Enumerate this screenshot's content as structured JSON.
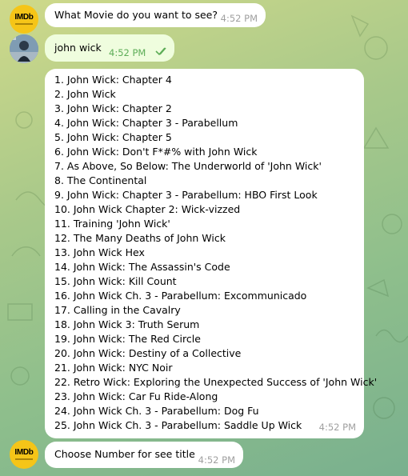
{
  "messages": [
    {
      "sender": "bot",
      "avatar_label": "IMDb",
      "text": "What Movie do you want to see?",
      "time": "4:52 PM"
    },
    {
      "sender": "user",
      "text": "john wick",
      "time": "4:52 PM",
      "status_icon": "double-check-icon"
    },
    {
      "sender": "bot",
      "time": "4:52 PM",
      "list": [
        "1. John Wick: Chapter 4",
        "2. John Wick",
        "3. John Wick: Chapter 2",
        "4. John Wick: Chapter 3 - Parabellum",
        "5. John Wick: Chapter 5",
        "6. John Wick: Don't F*#% with John Wick",
        "7. As Above, So Below: The Underworld of 'John Wick'",
        "8. The Continental",
        "9. John Wick: Chapter 3 - Parabellum: HBO First Look",
        "10. John Wick Chapter 2: Wick-vizzed",
        "11. Training 'John Wick'",
        "12. The Many Deaths of John Wick",
        "13. John Wick Hex",
        "14. John Wick: The Assassin's Code",
        "15. John Wick: Kill Count",
        "16. John Wick Ch. 3 - Parabellum: Excommunicado",
        "17. Calling in the Cavalry",
        "18. John Wick 3: Truth Serum",
        "19. John Wick: The Red Circle",
        "20. John Wick: Destiny of a Collective",
        "21. John Wick: NYC Noir",
        "22. Retro Wick: Exploring the Unexpected Success of 'John Wick'",
        "23. John Wick: Car Fu Ride-Along",
        "24. John Wick Ch. 3 - Parabellum: Dog Fu",
        "25. John Wick Ch. 3 - Parabellum: Saddle Up Wick"
      ]
    },
    {
      "sender": "bot",
      "avatar_label": "IMDb",
      "text": "Choose Number for see title",
      "time": "4:52 PM"
    }
  ],
  "colors": {
    "incoming": "#ffffff",
    "outgoing": "#effdde",
    "time_in": "#a0a0a0",
    "time_out": "#5dad57",
    "imdb": "#f5c518"
  }
}
